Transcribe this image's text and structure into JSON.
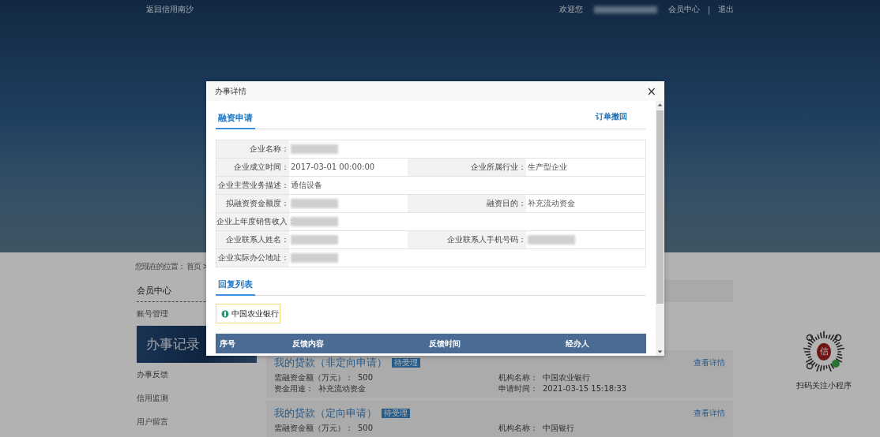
{
  "top_bar": {
    "back_link": "返回信用南沙",
    "welcome": "欢迎您",
    "username_blurred": true,
    "member_center": "会员中心",
    "separator": "|",
    "logout": "退出"
  },
  "breadcrumb": {
    "label": "您现在的位置：",
    "path": "首页 >"
  },
  "sidebar": {
    "title": "会员中心",
    "items": [
      {
        "label": "账号管理",
        "selected": false
      },
      {
        "label": "办事记录",
        "selected": true
      },
      {
        "label": "办事反馈",
        "selected": false
      },
      {
        "label": "信用监测",
        "selected": false
      },
      {
        "label": "用户留言",
        "selected": false
      }
    ]
  },
  "loans": [
    {
      "title": "我的贷款（非定向申请）",
      "status": "待受理",
      "link": "查看详情",
      "fields": [
        {
          "label": "需融资金额（万元）：",
          "value": "500"
        },
        {
          "label": "机构名称：",
          "value": "中国农业银行"
        },
        {
          "label": "资金用途：",
          "value": "补充流动资金"
        },
        {
          "label": "申请时间：",
          "value": "2021-03-15 15:18:33"
        }
      ]
    },
    {
      "title": "我的贷款（定向申请）",
      "status": "待受理",
      "link": "查看详情",
      "fields": [
        {
          "label": "需融资金额（万元）：",
          "value": "500"
        },
        {
          "label": "机构名称：",
          "value": "中国银行"
        }
      ]
    }
  ],
  "qr": {
    "logo_char": "信",
    "caption": "扫码关注小程序"
  },
  "modal": {
    "title": "办事详情",
    "close": "×",
    "application": {
      "title": "融资申请",
      "action": "订单撤回",
      "rows": [
        {
          "cells": [
            {
              "label": "企业名称：",
              "blurred": true
            }
          ]
        },
        {
          "cells": [
            {
              "label": "企业成立时间：",
              "value": "2017-03-01 00:00:00"
            },
            {
              "label": "企业所属行业：",
              "value": "生产型企业"
            }
          ]
        },
        {
          "cells": [
            {
              "label": "企业主营业务描述：",
              "value": "通信设备"
            }
          ]
        },
        {
          "cells": [
            {
              "label": "拟融资资金额度：",
              "blurred": true
            },
            {
              "label": "融资目的：",
              "value": "补充流动资金"
            }
          ]
        },
        {
          "cells": [
            {
              "label": "企业上年度销售收入：",
              "blurred": true
            }
          ]
        },
        {
          "cells": [
            {
              "label": "企业联系人姓名：",
              "blurred": true
            },
            {
              "label": "企业联系人手机号码：",
              "blurred": true
            }
          ]
        },
        {
          "cells": [
            {
              "label": "企业实际办公地址：",
              "blurred": true
            }
          ]
        }
      ]
    },
    "replies": {
      "title": "回复列表",
      "bank_logo": "中国农业银行",
      "columns": [
        "序号",
        "反馈内容",
        "反馈时间",
        "经办人"
      ]
    }
  }
}
